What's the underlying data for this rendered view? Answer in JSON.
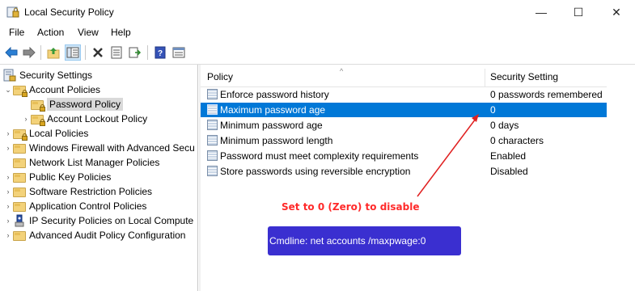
{
  "window": {
    "title": "Local Security Policy",
    "controls": {
      "minimize": "—",
      "maximize": "☐",
      "close": "✕"
    }
  },
  "menu": [
    "File",
    "Action",
    "View",
    "Help"
  ],
  "toolbar": {
    "icons": [
      "back-icon",
      "forward-icon",
      "up-folder-icon",
      "show-tree-icon",
      "delete-icon",
      "properties-icon",
      "export-icon",
      "help-icon",
      "console-tree-icon"
    ]
  },
  "tree": {
    "root": "Security Settings",
    "items": [
      {
        "label": "Account Policies",
        "expanded": true
      },
      {
        "label": "Password Policy",
        "selected": true
      },
      {
        "label": "Account Lockout Policy"
      },
      {
        "label": "Local Policies"
      },
      {
        "label": "Windows Firewall with Advanced Secu"
      },
      {
        "label": "Network List Manager Policies"
      },
      {
        "label": "Public Key Policies"
      },
      {
        "label": "Software Restriction Policies"
      },
      {
        "label": "Application Control Policies"
      },
      {
        "label": "IP Security Policies on Local Compute"
      },
      {
        "label": "Advanced Audit Policy Configuration"
      }
    ]
  },
  "list": {
    "columns": {
      "policy": "Policy",
      "setting": "Security Setting"
    },
    "rows": [
      {
        "policy": "Enforce password history",
        "setting": "0 passwords remembered"
      },
      {
        "policy": "Maximum password age",
        "setting": "0",
        "selected": true
      },
      {
        "policy": "Minimum password age",
        "setting": "0 days"
      },
      {
        "policy": "Minimum password length",
        "setting": "0 characters"
      },
      {
        "policy": "Password must meet complexity requirements",
        "setting": "Enabled"
      },
      {
        "policy": "Store passwords using reversible encryption",
        "setting": "Disabled"
      }
    ]
  },
  "annotation": {
    "note": "Set to 0 (Zero) to disable",
    "command": "Cmdline: net accounts /maxpwage:0",
    "note_color": "#ff2a2a",
    "box_color": "#3a2fd0"
  },
  "colors": {
    "selection": "#0078d7",
    "tree_selection": "#d9d9d9"
  }
}
